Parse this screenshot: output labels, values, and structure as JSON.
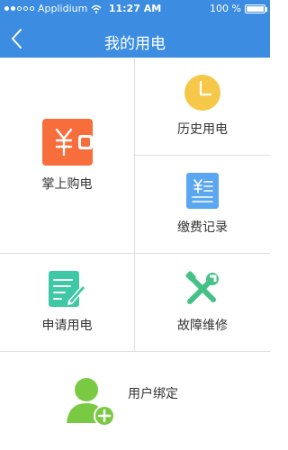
{
  "status_bar": {
    "carrier": "Applidium",
    "time": "11:27 AM",
    "battery": "100 %",
    "battery_level": 1.0
  },
  "header": {
    "title": "我的用电"
  },
  "menu": {
    "buy_power": {
      "label": "掌上购电",
      "icon": "wallet-yen-icon",
      "color": "#f76d3c"
    },
    "history": {
      "label": "历史用电",
      "icon": "clock-icon",
      "color": "#f6c84a"
    },
    "payment_records": {
      "label": "缴费记录",
      "icon": "receipt-icon",
      "color": "#5aa6f0"
    },
    "apply_power": {
      "label": "申请用电",
      "icon": "form-edit-icon",
      "color": "#3ec8a6"
    },
    "repair": {
      "label": "故障维修",
      "icon": "tools-icon",
      "color": "#46c186"
    },
    "bind_user": {
      "label": "用户绑定",
      "icon": "add-user-icon",
      "color": "#7ac943"
    }
  }
}
